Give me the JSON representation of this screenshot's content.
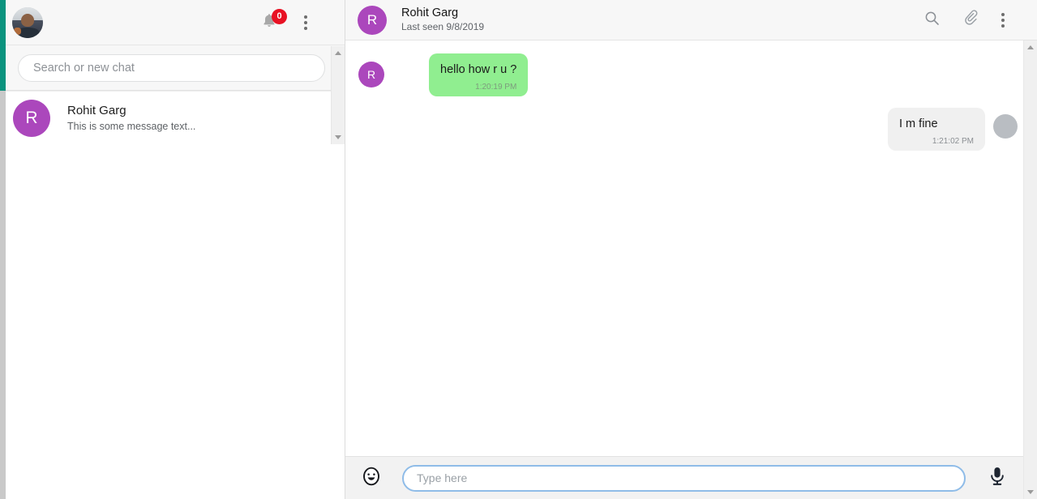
{
  "sidebar": {
    "topbar": {
      "user_avatar_name": "user-avatar",
      "notifications_count": "0",
      "bell_icon": "bell-icon",
      "menu_icon": "kebab-menu-icon"
    },
    "search": {
      "placeholder": "Search or new chat",
      "value": ""
    },
    "chats": [
      {
        "initial": "R",
        "name": "Rohit Garg",
        "preview": "This is some message text..."
      }
    ]
  },
  "chat": {
    "header": {
      "initial": "R",
      "name": "Rohit Garg",
      "status": "Last seen 9/8/2019",
      "actions": [
        {
          "icon": "search-icon",
          "label": "Search"
        },
        {
          "icon": "paperclip-icon",
          "label": "Attach"
        },
        {
          "icon": "kebab-menu-icon",
          "label": "More options"
        }
      ]
    },
    "messages": [
      {
        "direction": "in",
        "initial": "R",
        "text": "hello how r u ?",
        "time": "1:20:19 PM"
      },
      {
        "direction": "out",
        "text": "I m fine",
        "time": "1:21:02 PM"
      }
    ],
    "composer": {
      "emoji_icon": "emoji-smiley-icon",
      "placeholder": "Type here",
      "value": "",
      "mic_icon": "microphone-icon"
    }
  },
  "colors": {
    "accent_teal": "#0a937e",
    "avatar_purple": "#ab47bc",
    "incoming_bubble": "#90ee90",
    "outgoing_bubble": "#f0f0f0",
    "badge_red": "#e81123",
    "input_focus_blue": "#8fbce8"
  }
}
